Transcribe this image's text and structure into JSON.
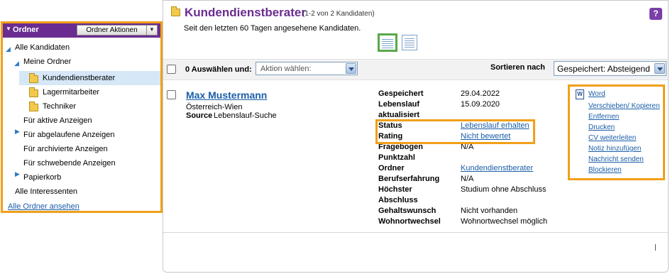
{
  "sidebar": {
    "title": "Ordner",
    "actions_label": "Ordner Aktionen",
    "items": [
      {
        "label": "Alle Kandidaten"
      },
      {
        "label": "Meine Ordner"
      },
      {
        "label": "Kundendienstberater"
      },
      {
        "label": "Lagermitarbeiter"
      },
      {
        "label": "Techniker"
      },
      {
        "label": "Für aktive Anzeigen"
      },
      {
        "label": "Für abgelaufene Anzeigen"
      },
      {
        "label": "Für archivierte Anzeigen"
      },
      {
        "label": "Für schwebende Anzeigen"
      },
      {
        "label": "Papierkorb"
      },
      {
        "label": "Alle Interessenten"
      }
    ],
    "view_all": "Alle Ordner ansehen"
  },
  "main": {
    "title": "Kundendienstberater",
    "count": "(1-2 von 2 Kandidaten)",
    "subtitle": "Seit den letzten 60 Tagen angesehene Kandidaten.",
    "help": "?"
  },
  "toolbar": {
    "select_label": "0 Auswählen und:",
    "action_placeholder": "Aktion wählen:",
    "sort_label": "Sortieren nach",
    "sort_value": "Gespeichert: Absteigend"
  },
  "candidate": {
    "name": "Max Mustermann",
    "location": "Österreich-Wien",
    "source_key": "Source",
    "source_value": "Lebenslauf-Suche",
    "details": [
      {
        "key": "Gespeichert",
        "value": "29.04.2022",
        "link": false
      },
      {
        "key": "Lebenslauf",
        "value": "15.09.2020",
        "link": false
      },
      {
        "key": "aktualisiert",
        "value": "",
        "link": false
      },
      {
        "key": "Status",
        "value": "Lebenslauf erhalten",
        "link": true
      },
      {
        "key": "Rating",
        "value": "Nicht bewertet",
        "link": true
      },
      {
        "key": "Fragebogen",
        "value": "N/A",
        "link": false
      },
      {
        "key": "Punktzahl",
        "value": "",
        "link": false
      },
      {
        "key": "Ordner",
        "value": "Kundendienstberater",
        "link": true
      },
      {
        "key": "Berufserfahrung",
        "value": "N/A",
        "link": false
      },
      {
        "key": "Höchster",
        "value": "Studium ohne Abschluss",
        "link": false
      },
      {
        "key": "Abschluss",
        "value": "",
        "link": false
      },
      {
        "key": "Gehaltswunsch",
        "value": "Nicht vorhanden",
        "link": false
      },
      {
        "key": "Wohnortwechsel",
        "value": "Wohnortwechsel möglich",
        "link": false
      }
    ],
    "actions": [
      "Word",
      "Verschieben/ Kopieren",
      "Entfernen",
      "Drucken",
      "CV weiterleiten",
      "Notiz hinzufügen",
      "Nachricht senden",
      "Blockieren"
    ]
  },
  "colors": {
    "accent_purple": "#6a2c91",
    "highlight_orange": "#f0a01a",
    "link_blue": "#1a5ea8",
    "selected_bg": "#d6e8f7"
  }
}
